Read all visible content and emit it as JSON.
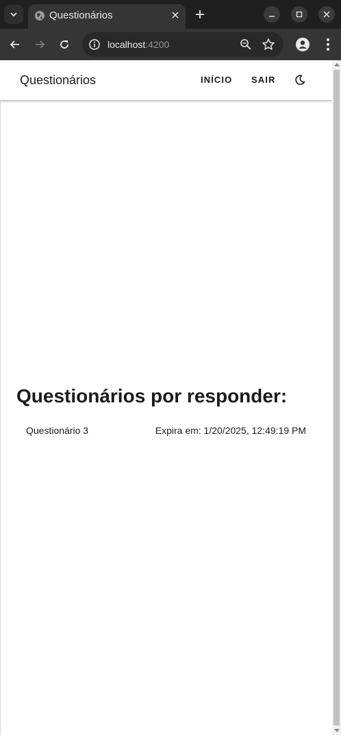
{
  "browser": {
    "tab_title": "Questionários",
    "url_host": "localhost",
    "url_port": ":4200"
  },
  "app": {
    "title": "Questionários",
    "nav": {
      "home_label": "INÍCIO",
      "logout_label": "SAIR"
    },
    "theme_icon": "moon-icon"
  },
  "main": {
    "section_title": "Questionários por responder:",
    "questionnaires": [
      {
        "name": "Questionário 3",
        "expiry": "Expira em: 1/20/2025, 12:49:19 PM"
      }
    ]
  },
  "colors": {
    "browser_dark": "#1f1f1f",
    "toolbar": "#353535",
    "page_bg": "#ffffff",
    "text": "#1b1b1b"
  }
}
